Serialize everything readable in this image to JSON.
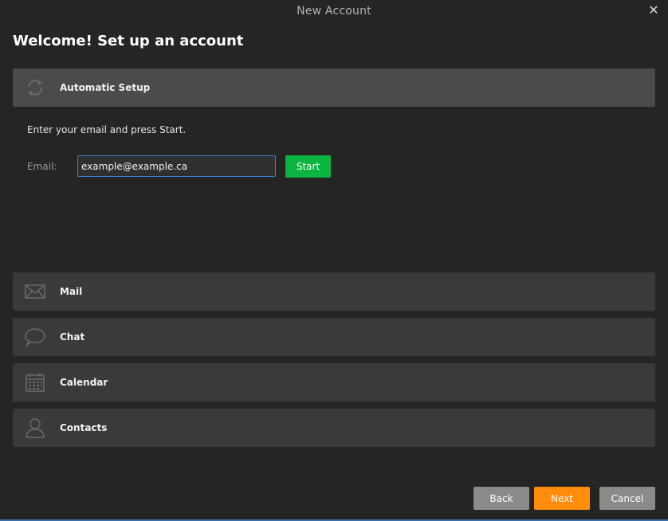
{
  "window": {
    "title": "New Account",
    "close_glyph": "✕"
  },
  "page": {
    "title": "Welcome! Set up an account"
  },
  "automatic_setup": {
    "label": "Automatic Setup",
    "icon": "sync-icon",
    "intro": "Enter your email and press Start.",
    "email_label": "Email:",
    "email_value": "example@example.ca",
    "start_label": "Start"
  },
  "sections": {
    "mail": {
      "label": "Mail",
      "icon": "mail-icon"
    },
    "chat": {
      "label": "Chat",
      "icon": "chat-icon"
    },
    "calendar": {
      "label": "Calendar",
      "icon": "calendar-icon"
    },
    "contacts": {
      "label": "Contacts",
      "icon": "contact-icon"
    }
  },
  "footer": {
    "back_label": "Back",
    "next_label": "Next",
    "cancel_label": "Cancel"
  },
  "colors": {
    "background": "#252624",
    "section": "#3a3a3a",
    "section_active": "#4b4b4b",
    "start_button": "#0cb441",
    "next_button": "#ff8c0a",
    "secondary_button": "#8a8a8a",
    "input_focus_border": "#3f7fd6"
  }
}
